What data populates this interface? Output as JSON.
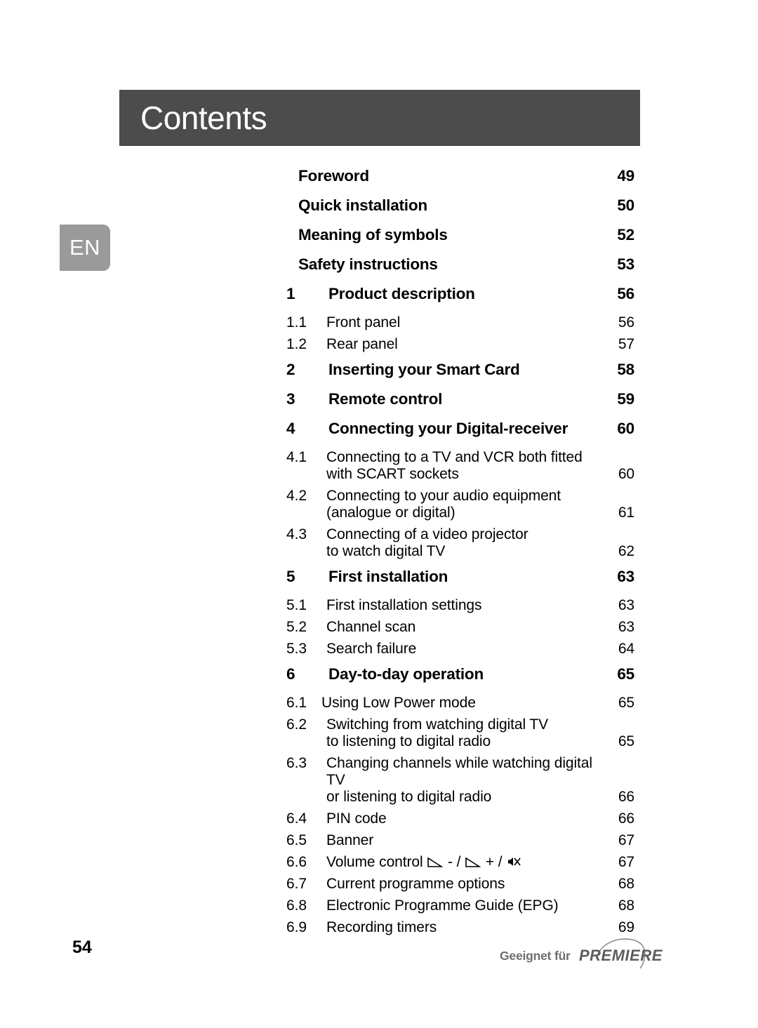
{
  "language_tab": {
    "label": "EN"
  },
  "header": {
    "title": "Contents"
  },
  "toc": {
    "entries": [
      {
        "kind": "major",
        "number": "",
        "label": "Foreword",
        "page": "49"
      },
      {
        "kind": "major",
        "number": "",
        "label": "Quick installation",
        "page": "50"
      },
      {
        "kind": "major",
        "number": "",
        "label": "Meaning of symbols",
        "page": "52"
      },
      {
        "kind": "major",
        "number": "",
        "label": "Safety instructions",
        "page": "53"
      },
      {
        "kind": "major",
        "number": "1",
        "label": "Product description",
        "page": "56"
      },
      {
        "kind": "sub",
        "number": "1.1",
        "label": "Front panel",
        "label2": "",
        "page": "56"
      },
      {
        "kind": "sub",
        "number": "1.2",
        "label": "Rear panel",
        "label2": "",
        "page": "57"
      },
      {
        "kind": "major",
        "number": "2",
        "label": "Inserting your Smart Card",
        "page": "58"
      },
      {
        "kind": "major",
        "number": "3",
        "label": "Remote control",
        "page": "59"
      },
      {
        "kind": "major",
        "number": "4",
        "label": "Connecting your Digital-receiver",
        "page": "60"
      },
      {
        "kind": "sub",
        "number": "4.1",
        "label": "Connecting to a TV and VCR both fitted",
        "label2": "with SCART sockets",
        "page": "60"
      },
      {
        "kind": "sub",
        "number": "4.2",
        "label": "Connecting to your audio equipment",
        "label2": "(analogue or digital)",
        "page": "61"
      },
      {
        "kind": "sub",
        "number": "4.3",
        "label": "Connecting of a video projector",
        "label2": "to watch digital TV",
        "page": "62"
      },
      {
        "kind": "major",
        "number": "5",
        "label": "First installation",
        "page": "63"
      },
      {
        "kind": "sub",
        "number": "5.1",
        "label": "First installation settings",
        "label2": "",
        "page": "63"
      },
      {
        "kind": "sub",
        "number": "5.2",
        "label": "Channel scan",
        "label2": "",
        "page": "63"
      },
      {
        "kind": "sub",
        "number": "5.3",
        "label": "Search failure",
        "label2": "",
        "page": "64"
      },
      {
        "kind": "major",
        "number": "6",
        "label": "Day-to-day operation",
        "page": "65"
      },
      {
        "kind": "sub",
        "number": "6.1",
        "label": "Using Low Power mode",
        "label2": "",
        "page": "65"
      },
      {
        "kind": "sub",
        "number": "6.2",
        "label": "Switching from watching digital TV",
        "label2": "to listening to digital radio",
        "page": "65"
      },
      {
        "kind": "sub",
        "number": "6.3",
        "label": "Changing channels while watching digital TV",
        "label2": "or listening to digital radio",
        "page": "66"
      },
      {
        "kind": "sub",
        "number": "6.4",
        "label": "PIN code",
        "label2": "",
        "page": "66"
      },
      {
        "kind": "sub",
        "number": "6.5",
        "label": "Banner",
        "label2": "",
        "page": "67"
      },
      {
        "kind": "sub",
        "number": "6.6",
        "label": "Volume control",
        "label2": "",
        "page": "67",
        "symbols": [
          "volume-down-icon",
          "volume-up-icon",
          "mute-icon"
        ],
        "symbol_text": "- / + /"
      },
      {
        "kind": "sub",
        "number": "6.7",
        "label": "Current programme options",
        "label2": "",
        "page": "68"
      },
      {
        "kind": "sub",
        "number": "6.8",
        "label": "Electronic Programme Guide (EPG)",
        "label2": "",
        "page": "68"
      },
      {
        "kind": "sub",
        "number": "6.9",
        "label": "Recording timers",
        "label2": "",
        "page": "69"
      }
    ]
  },
  "footer": {
    "page_number": "54",
    "logo": {
      "prefix": "Geeignet für",
      "brand": "PREMIERE"
    }
  },
  "colors": {
    "header_bar": "#4c4c4c",
    "language_tab": "#9a9a9a",
    "text": "#000000",
    "logo_gray": "#6e6e6e",
    "page_background": "#ffffff"
  }
}
